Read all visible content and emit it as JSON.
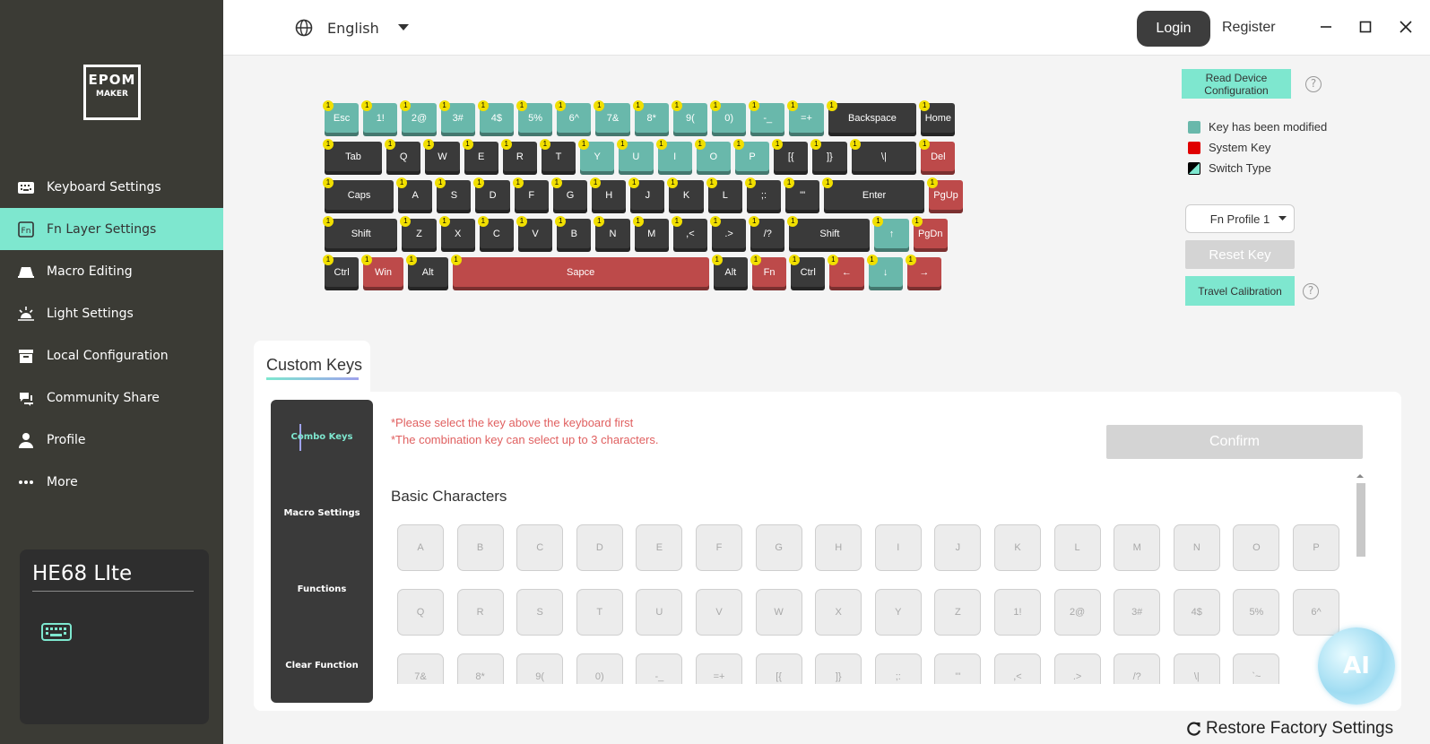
{
  "topbar": {
    "language": "English",
    "login": "Login",
    "register": "Register"
  },
  "logo": {
    "line1": "EPOM",
    "line2": "MAKER"
  },
  "nav": [
    {
      "label": "Keyboard Settings",
      "icon": "keyboard-icon"
    },
    {
      "label": "Fn Layer Settings",
      "icon": "fn-icon",
      "active": true
    },
    {
      "label": "Macro Editing",
      "icon": "macro-icon"
    },
    {
      "label": "Light Settings",
      "icon": "light-icon"
    },
    {
      "label": "Local Configuration",
      "icon": "archive-icon"
    },
    {
      "label": "Community Share",
      "icon": "share-icon"
    },
    {
      "label": "Profile",
      "icon": "user-icon"
    },
    {
      "label": "More",
      "icon": "more-icon"
    }
  ],
  "device": {
    "name": "HE68 LIte"
  },
  "keyboard": {
    "layer_badge": "1",
    "rows": [
      [
        [
          "Esc",
          "t"
        ],
        [
          "1!",
          "t"
        ],
        [
          "2@",
          "t"
        ],
        [
          "3#",
          "t"
        ],
        [
          "4$",
          "t"
        ],
        [
          "5%",
          "t"
        ],
        [
          "6^",
          "t"
        ],
        [
          "7&",
          "t"
        ],
        [
          "8*",
          "t"
        ],
        [
          "9(",
          "t"
        ],
        [
          "0)",
          "t"
        ],
        [
          "-_",
          "t"
        ],
        [
          "=+",
          "t"
        ],
        [
          "Backspace",
          "d"
        ],
        [
          "Home",
          "d"
        ]
      ],
      [
        [
          "Tab",
          "d"
        ],
        [
          "Q",
          "d"
        ],
        [
          "W",
          "d"
        ],
        [
          "E",
          "d"
        ],
        [
          "R",
          "d"
        ],
        [
          "T",
          "d"
        ],
        [
          "Y",
          "t"
        ],
        [
          "U",
          "t"
        ],
        [
          "I",
          "t"
        ],
        [
          "O",
          "t"
        ],
        [
          "P",
          "t"
        ],
        [
          "[{",
          "d"
        ],
        [
          "]}",
          "d"
        ],
        [
          "\\|",
          "d"
        ],
        [
          "Del",
          "r"
        ]
      ],
      [
        [
          "Caps",
          "d"
        ],
        [
          "A",
          "d"
        ],
        [
          "S",
          "d"
        ],
        [
          "D",
          "d"
        ],
        [
          "F",
          "d"
        ],
        [
          "G",
          "d"
        ],
        [
          "H",
          "d"
        ],
        [
          "J",
          "d"
        ],
        [
          "K",
          "d"
        ],
        [
          "L",
          "d"
        ],
        [
          ";:",
          "d"
        ],
        [
          "'\"",
          "d"
        ],
        [
          "Enter",
          "d"
        ],
        [
          "PgUp",
          "r"
        ]
      ],
      [
        [
          "Shift",
          "d"
        ],
        [
          "Z",
          "d"
        ],
        [
          "X",
          "d"
        ],
        [
          "C",
          "d"
        ],
        [
          "V",
          "d"
        ],
        [
          "B",
          "d"
        ],
        [
          "N",
          "d"
        ],
        [
          "M",
          "d"
        ],
        [
          ",<",
          "d"
        ],
        [
          ".>",
          "d"
        ],
        [
          "/?",
          "d"
        ],
        [
          "Shift",
          "d"
        ],
        [
          "↑",
          "t"
        ],
        [
          "PgDn",
          "r"
        ]
      ],
      [
        [
          "Ctrl",
          "d"
        ],
        [
          "Win",
          "r"
        ],
        [
          "Alt",
          "d"
        ],
        [
          "Sapce",
          "r"
        ],
        [
          "Alt",
          "d"
        ],
        [
          "Fn",
          "r"
        ],
        [
          "Ctrl",
          "d"
        ],
        [
          "←",
          "r"
        ],
        [
          "↓",
          "t"
        ],
        [
          "→",
          "r"
        ]
      ]
    ]
  },
  "right": {
    "read_device": "Read Device Configuration",
    "legend": [
      {
        "label": "Key has been modified",
        "color": "#69b8ab"
      },
      {
        "label": "System Key",
        "color": "#e00000"
      },
      {
        "label": "Switch Type",
        "color": "#000000"
      }
    ],
    "profile": "Fn Profile 1",
    "reset": "Reset Key",
    "travel": "Travel Calibration"
  },
  "custom": {
    "tab": "Custom Keys",
    "sub": [
      "Combo Keys",
      "Macro Settings",
      "Functions",
      "Clear Function"
    ],
    "note1": "*Please select the key above the keyboard first",
    "note2": "*The combination key can select up to 3 characters.",
    "confirm": "Confirm",
    "section": "Basic Characters",
    "chars": [
      "A",
      "B",
      "C",
      "D",
      "E",
      "F",
      "G",
      "H",
      "I",
      "J",
      "K",
      "L",
      "M",
      "N",
      "O",
      "P",
      "Q",
      "R",
      "S",
      "T",
      "U",
      "V",
      "W",
      "X",
      "Y",
      "Z",
      "1!",
      "2@",
      "3#",
      "4$",
      "5%",
      "6^",
      "7&",
      "8*",
      "9(",
      "0)",
      "-_",
      "=+",
      "[{",
      "]}",
      ";:",
      "'\"",
      ",<",
      ".>",
      "/?",
      "\\|",
      "`~"
    ]
  },
  "ai_badge": "AI",
  "restore": "Restore Factory Settings"
}
